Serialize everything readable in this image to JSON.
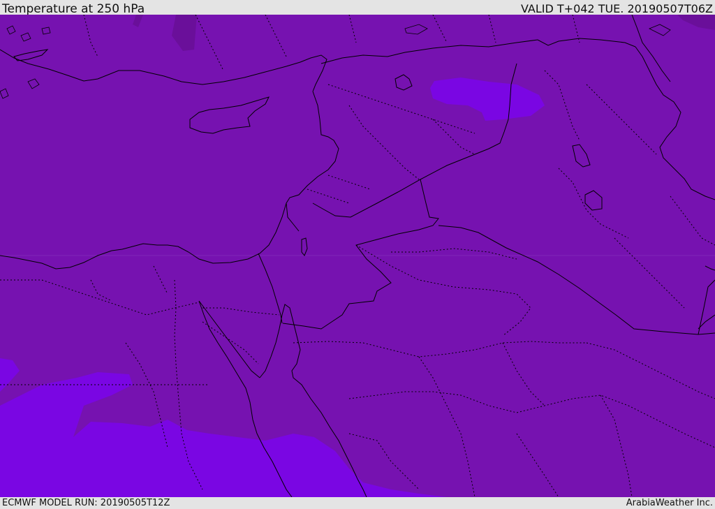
{
  "header": {
    "title": "Temperature at 250 hPa",
    "valid_time": "VALID T+042 TUE. 20190507T06Z"
  },
  "footer": {
    "model_run": "ECMWF MODEL RUN: 20190505T12Z",
    "credit": "ArabiaWeather Inc."
  },
  "map": {
    "field": "Temperature at 250 hPa",
    "colors": {
      "base_fill": "#7612b0",
      "warm_band": "#7a06e3",
      "cold_patch": "#6a0f9a",
      "coastline": "#000000",
      "borders": "#000000"
    }
  }
}
